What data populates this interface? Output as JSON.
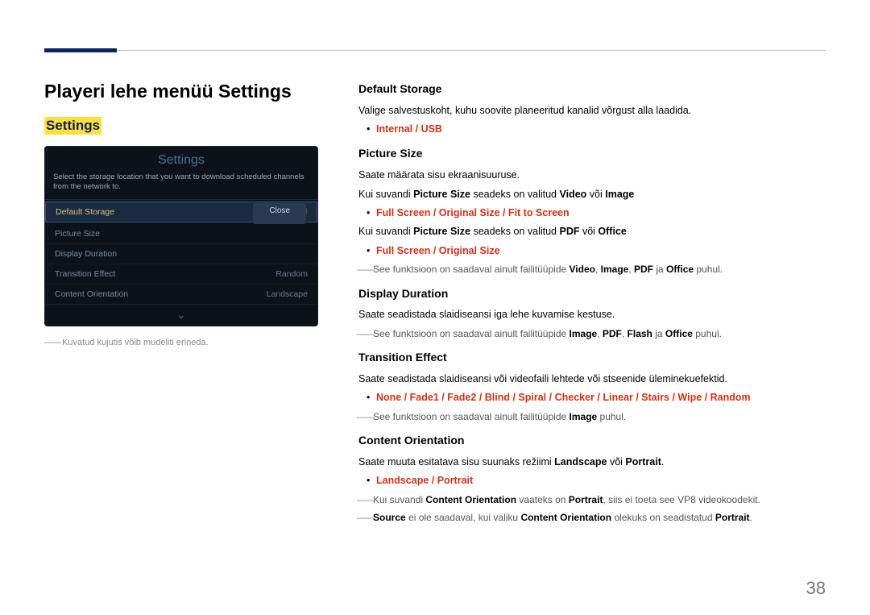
{
  "header": {
    "h1": "Playeri lehe menüü Settings",
    "h2": "Settings"
  },
  "mock": {
    "title": "Settings",
    "desc": "Select the storage location that you want to download scheduled channels from the network to.",
    "rows": [
      {
        "label": "Default Storage",
        "value": "Internal",
        "selected": true
      },
      {
        "label": "Picture Size",
        "value": "",
        "selected": false
      },
      {
        "label": "Display Duration",
        "value": "",
        "selected": false
      },
      {
        "label": "Transition Effect",
        "value": "Random",
        "selected": false
      },
      {
        "label": "Content Orientation",
        "value": "Landscape",
        "selected": false
      }
    ],
    "close": "Close",
    "chevron": "⌄"
  },
  "caption": "Kuvatud kujutis võib mudeliti erineda.",
  "sections": {
    "default_storage": {
      "title": "Default Storage",
      "p1": "Valige salvestuskoht, kuhu soovite planeeritud kanalid võrgust alla laadida.",
      "opt": "Internal / USB"
    },
    "picture_size": {
      "title": "Picture Size",
      "p1": "Saate määrata sisu ekraanisuuruse.",
      "p2a": "Kui suvandi ",
      "p2b": " seadeks on valitud ",
      "p2c": " või ",
      "vi_video": "Video",
      "vi_image": "Image",
      "opt1": "Full Screen / Original Size / Fit to Screen",
      "p3a": "Kui suvandi ",
      "p3b": " seadeks on valitud ",
      "p3c": " või ",
      "vi_pdf": "PDF",
      "vi_office": "Office",
      "opt2": "Full Screen / Original Size",
      "note_a": "See funktsioon on saadaval ainult failitüüpide ",
      "note_v": "Video",
      "note_i": "Image",
      "note_p": "PDF",
      "note_j": " ja ",
      "note_o": "Office",
      "note_end": " puhul.",
      "ps_label": "Picture Size"
    },
    "display_duration": {
      "title": "Display Duration",
      "p1": "Saate seadistada slaidiseansi iga lehe kuvamise kestuse.",
      "note_a": "See funktsioon on saadaval ainult failitüüpide ",
      "note_i": "Image",
      "note_p": "PDF",
      "note_f": "Flash",
      "note_j": " ja ",
      "note_o": "Office",
      "note_end": " puhul."
    },
    "transition_effect": {
      "title": "Transition Effect",
      "p1": "Saate seadistada slaidiseansi või videofaili lehtede või stseenide üleminekuefektid.",
      "opt": "None / Fade1 / Fade2 / Blind / Spiral / Checker / Linear / Stairs / Wipe / Random",
      "note_a": "See funktsioon on saadaval ainult failitüüpide ",
      "note_i": "Image",
      "note_end": " puhul."
    },
    "content_orientation": {
      "title": "Content Orientation",
      "p1a": "Saate muuta esitatava sisu suunaks režiimi ",
      "p1_land": "Landscape",
      "p1_voi": " või ",
      "p1_port": "Portrait",
      "p1_end": ".",
      "opt": "Landscape / Portrait",
      "note1_a": "Kui suvandi ",
      "note1_co": "Content Orientation",
      "note1_b": " vaateks on ",
      "note1_port": "Portrait",
      "note1_c": ", siis ei toeta see VP8 videokoodekit.",
      "note2_src": "Source",
      "note2_a": " ei ole saadaval, kui valiku ",
      "note2_co": "Content Orientation",
      "note2_b": " olekuks on seadistatud ",
      "note2_port": "Portrait",
      "note2_end": "."
    }
  },
  "page": "38"
}
